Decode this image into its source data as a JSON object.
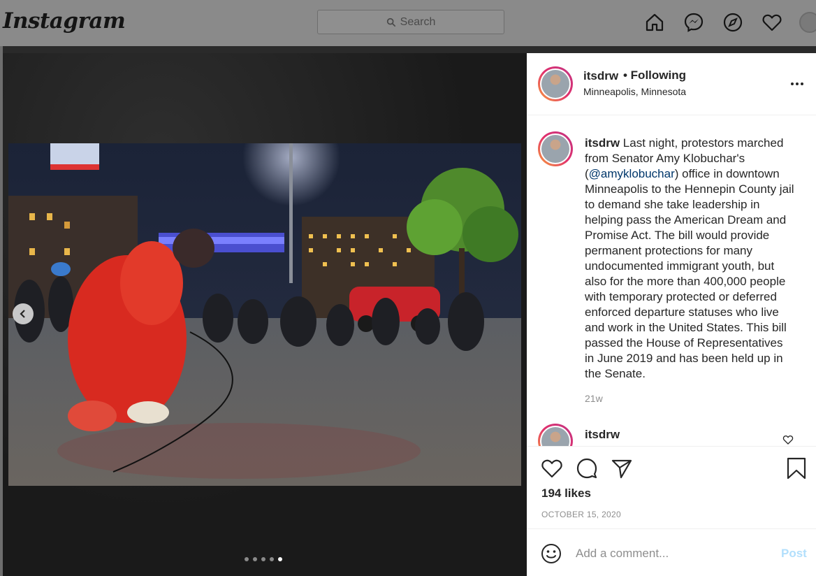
{
  "app": {
    "logo": "Instagram"
  },
  "search": {
    "placeholder": "Search"
  },
  "nav": {
    "icons": [
      "home-icon",
      "messenger-icon",
      "explore-icon",
      "heart-icon",
      "profile-avatar"
    ]
  },
  "carousel": {
    "slide_count": 5,
    "active_index": 4
  },
  "post": {
    "username": "itsdrw",
    "follow_status": "• Following",
    "location": "Minneapolis, Minnesota",
    "caption": {
      "username": "itsdrw",
      "text_before_mention": " Last night, protestors marched from Senator Amy Klobuchar's (",
      "mention": "@amyklobuchar",
      "text_after_mention": ") office in downtown Minneapolis to the Hennepin County jail to demand she take leadership in helping pass the American Dream and Promise Act. The bill would provide permanent protections for many undocumented immigrant youth, but also for the more than 400,000 people with temporary protected or deferred enforced departure statuses who live and work in the United States. This bill passed the House of Representatives in June 2019 and has been held up in the Senate.",
      "age": "21w"
    },
    "next_comment": {
      "username": "itsdrw"
    },
    "likes": "194 likes",
    "date": "OCTOBER 15, 2020",
    "comment_placeholder": "Add a comment...",
    "post_button": "Post"
  },
  "colors": {
    "accent_link": "#00376b",
    "post_disabled": "#b2dffc",
    "muted": "#8e8e8e"
  }
}
